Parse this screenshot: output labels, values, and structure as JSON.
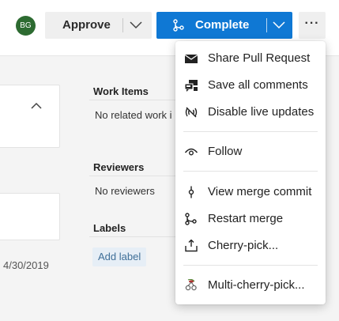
{
  "header": {
    "avatar_initials": "BG",
    "approve_label": "Approve",
    "complete_label": "Complete",
    "more_label": "···",
    "accent_color": "#0f78d4"
  },
  "left_panel": {
    "date_text": "4/30/2019"
  },
  "sidebar": {
    "work_items_title": "Work Items",
    "work_items_text": "No related work i",
    "reviewers_title": "Reviewers",
    "reviewers_text": "No reviewers",
    "labels_title": "Labels",
    "add_label": "Add label"
  },
  "menu": {
    "items": [
      {
        "label": "Share Pull Request",
        "icon": "envelope-icon"
      },
      {
        "label": "Save all comments",
        "icon": "save-comments-icon"
      },
      {
        "label": "Disable live updates",
        "icon": "live-updates-off-icon"
      },
      {
        "label": "Follow",
        "icon": "eye-icon"
      },
      {
        "label": "View merge commit",
        "icon": "commit-icon"
      },
      {
        "label": "Restart merge",
        "icon": "branch-icon"
      },
      {
        "label": "Cherry-pick...",
        "icon": "cherry-pick-icon"
      },
      {
        "label": "Multi-cherry-pick...",
        "icon": "multi-cherry-pick-icon"
      }
    ]
  }
}
